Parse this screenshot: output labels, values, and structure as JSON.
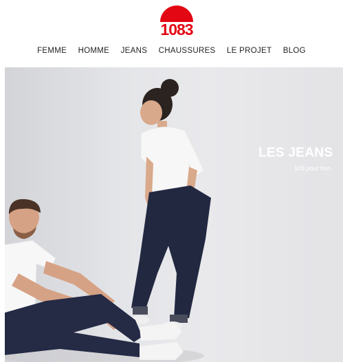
{
  "brand": {
    "logo_text": "1083",
    "accent_color": "#e30613"
  },
  "nav": {
    "items": [
      {
        "label": "FEMME"
      },
      {
        "label": "HOMME"
      },
      {
        "label": "JEANS"
      },
      {
        "label": "CHAUSSURES"
      },
      {
        "label": "LE PROJET"
      },
      {
        "label": "BLOG"
      }
    ]
  },
  "hero": {
    "title": "LES JEANS",
    "subtitle": "103 pour hon"
  }
}
